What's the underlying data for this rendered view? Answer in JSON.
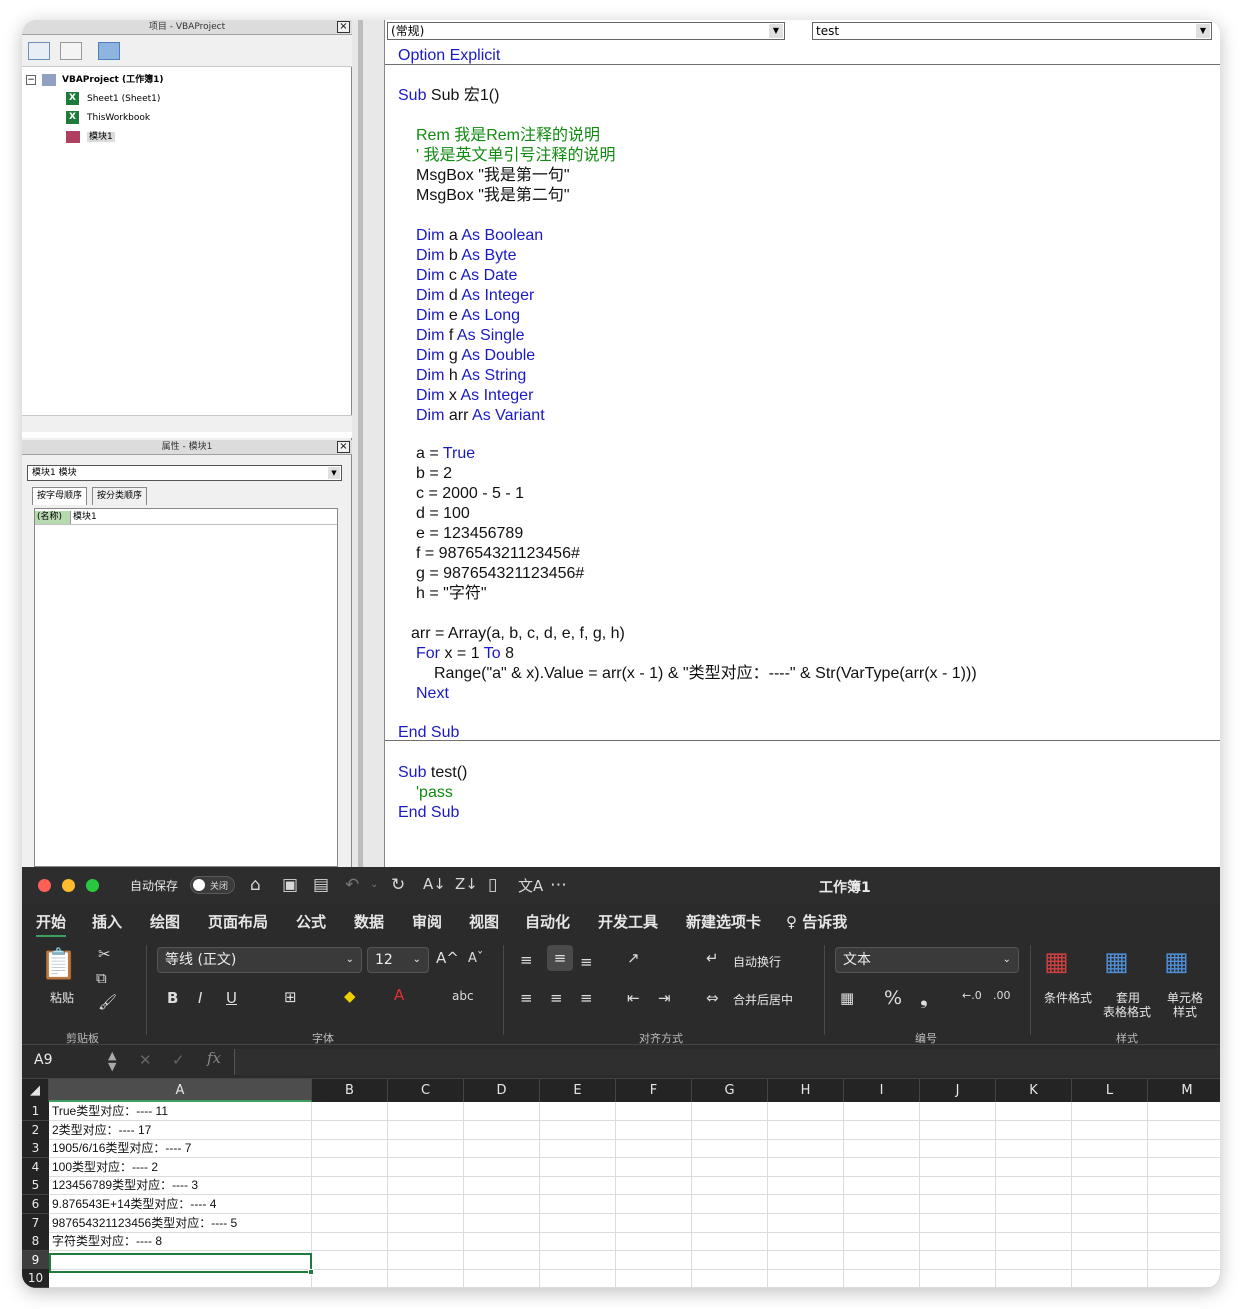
{
  "vbe": {
    "project_title": "项目 - VBAProject",
    "tree": {
      "root": "VBAProject (工作簿1)",
      "sheet1": "Sheet1 (Sheet1)",
      "thisworkbook": "ThisWorkbook",
      "module": "模块1"
    },
    "properties_title": "属性 - 模块1",
    "properties_combo": "模块1  模块",
    "tabs": [
      "按字母顺序",
      "按分类顺序"
    ],
    "prop_name_key": "(名称)",
    "prop_name_val": "模块1",
    "code_combo_left": "(常规)",
    "code_combo_right": "test",
    "code": {
      "l1": "Option Explicit",
      "l2": "Sub 宏1()",
      "rem": "Rem 我是Rem注释的说明",
      "quote": "' 我是英文单引号注释的说明",
      "msg1": "MsgBox \"我是第一句\"",
      "msg2": "MsgBox \"我是第二句\"",
      "dims": [
        {
          "v": "a",
          "t": "Boolean"
        },
        {
          "v": "b",
          "t": "Byte"
        },
        {
          "v": "c",
          "t": "Date"
        },
        {
          "v": "d",
          "t": "Integer"
        },
        {
          "v": "e",
          "t": "Long"
        },
        {
          "v": "f",
          "t": "Single"
        },
        {
          "v": "g",
          "t": "Double"
        },
        {
          "v": "h",
          "t": "String"
        },
        {
          "v": "x",
          "t": "Integer"
        },
        {
          "v": "arr",
          "t": "Variant"
        }
      ],
      "a_assign_pre": "a = ",
      "a_assign_val": "True",
      "b_assign": "b = 2",
      "c_assign": "c = 2000 - 5 - 1",
      "d_assign": "d = 100",
      "e_assign": "e = 123456789",
      "f_assign": "f = 987654321123456#",
      "g_assign": "g = 987654321123456#",
      "h_assign": "h = \"字符\"",
      "arr_assign": "arr = Array(a, b, c, d, e, f, g, h)",
      "for_x": "x = 1",
      "for_to": "To",
      "for_end": "8",
      "range_line": "Range(\"a\" & x).Value = arr(x - 1) & \"类型对应：----\" & Str(VarType(arr(x - 1)))",
      "next": "Next",
      "end_sub": "End Sub",
      "sub_test": "test()",
      "pass": "'pass",
      "end_sub2": "End Sub",
      "kw_dim": "Dim",
      "kw_as": "As",
      "kw_sub": "Sub",
      "kw_for": "For"
    }
  },
  "excel": {
    "autosave_label": "自动保存",
    "toggle_label": "关闭",
    "workbook_title": "工作簿1",
    "tabs": [
      "开始",
      "插入",
      "绘图",
      "页面布局",
      "公式",
      "数据",
      "审阅",
      "视图",
      "自动化",
      "开发工具",
      "新建选项卡",
      "告诉我"
    ],
    "ribbon": {
      "paste": "粘贴",
      "clipboard": "剪贴板",
      "font_name": "等线 (正文)",
      "font_size": "12",
      "font_group": "字体",
      "wrap": "自动换行",
      "merge": "合并后居中",
      "align_group": "对齐方式",
      "number_format": "文本",
      "number_group": "编号",
      "cond_format": "条件格式",
      "table_format_1": "套用",
      "table_format_2": "表格格式",
      "cell_style_1": "单元格",
      "cell_style_2": "样式",
      "style_group": "样式",
      "bold": "B",
      "italic": "I",
      "underline": "U"
    },
    "namebox": "A9",
    "columns": [
      "A",
      "B",
      "C",
      "D",
      "E",
      "F",
      "G",
      "H",
      "I",
      "J",
      "K",
      "L",
      "M"
    ],
    "rows": [
      {
        "n": "1",
        "a": "True类型对应：---- 11"
      },
      {
        "n": "2",
        "a": "2类型对应：---- 17"
      },
      {
        "n": "3",
        "a": "1905/6/16类型对应：---- 7"
      },
      {
        "n": "4",
        "a": "100类型对应：---- 2"
      },
      {
        "n": "5",
        "a": "123456789类型对应：---- 3"
      },
      {
        "n": "6",
        "a": "9.876543E+14类型对应：---- 4"
      },
      {
        "n": "7",
        "a": "987654321123456类型对应：---- 5"
      },
      {
        "n": "8",
        "a": "字符类型对应：---- 8"
      },
      {
        "n": "9",
        "a": ""
      },
      {
        "n": "10",
        "a": ""
      }
    ],
    "accent": "#3e9e5e"
  }
}
